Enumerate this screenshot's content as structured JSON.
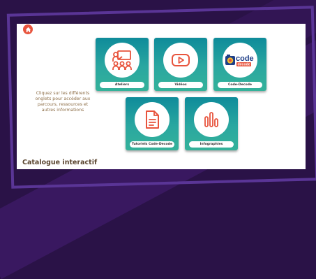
{
  "instructions": "Cliquez sur les différents onglets pour accéder aux parcours, ressources et autres informations",
  "page_title": "Catalogue interactif",
  "colors": {
    "accent": "#e8543d",
    "tile": "#1a9aa0",
    "background": "#2a1247",
    "frame": "#5a3596"
  },
  "tiles": [
    {
      "label": "Ateliers",
      "icon": "workshop-icon"
    },
    {
      "label": "Vidéos",
      "icon": "video-play-icon"
    },
    {
      "label": "Code-Decode",
      "icon": "code-decode-logo"
    },
    {
      "label": "Tutoriels Code-Decode",
      "icon": "document-icon"
    },
    {
      "label": "Infographies",
      "icon": "bar-chart-icon"
    }
  ],
  "logo": {
    "word1": "code",
    "word2": "decode"
  }
}
